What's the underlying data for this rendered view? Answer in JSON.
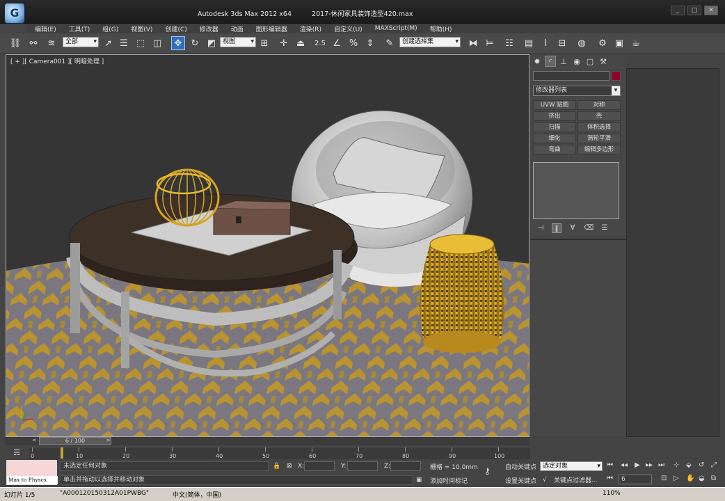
{
  "app": {
    "title": "Autodesk 3ds Max  2012 x64",
    "file": "2017-休闲家具装饰造型420.max",
    "logo_letter": "G"
  },
  "window_buttons": [
    "_",
    "□",
    "✕"
  ],
  "menu": [
    "编辑(E)",
    "工具(T)",
    "组(G)",
    "视图(V)",
    "创建(C)",
    "修改器",
    "动画",
    "图形编辑器",
    "渲染(R)",
    "自定义(U)",
    "MAXScript(M)",
    "帮助(H)"
  ],
  "toolbar": {
    "selection_filter": "全部",
    "ref_coord": "视图",
    "named_selection": "创建选择集",
    "snap_label": "2.5"
  },
  "viewport": {
    "label": "[ + ][ Camera001 ][ 明暗处理 ]"
  },
  "command_panel": {
    "modifier_list": "修改器列表",
    "modifier_buttons": [
      "UVW 贴图",
      "对称",
      "挤出",
      "壳",
      "扫描",
      "体积选择",
      "细化",
      "涡轮平滑",
      "弯曲",
      "编辑多边形"
    ]
  },
  "timeline": {
    "frame_display": "6 / 100",
    "ticks": [
      "0",
      "10",
      "20",
      "30",
      "40",
      "50",
      "60",
      "70",
      "80",
      "90",
      "100"
    ]
  },
  "status": {
    "selection_status": "未选定任何对象",
    "prompt": "单击并拖动以选择并移动对象",
    "x_label": "X:",
    "y_label": "Y:",
    "z_label": "Z:",
    "grid": "栅格 = 10.0mm",
    "add_time_tag": "添加时间标记",
    "auto_key": "自动关键点",
    "set_key": "设置关键点",
    "selected_object": "选定对象",
    "key_filters": "关键点过滤器...",
    "current_frame": "6",
    "maxscript_label": "Max to Physcx"
  },
  "taskbar": {
    "slide": "幻灯片 1/5",
    "doc": "\"A000120150312A01PWBG\"",
    "lang": "中文(简体，中国)",
    "zoom": "110%"
  },
  "colors": {
    "viewport_bg": "#353535",
    "gold": "#d9a520",
    "rug_gray": "#7a7680",
    "table_top": "#3b2e26",
    "active_blue": "#2f6fb8",
    "object_color": "#93002a"
  }
}
